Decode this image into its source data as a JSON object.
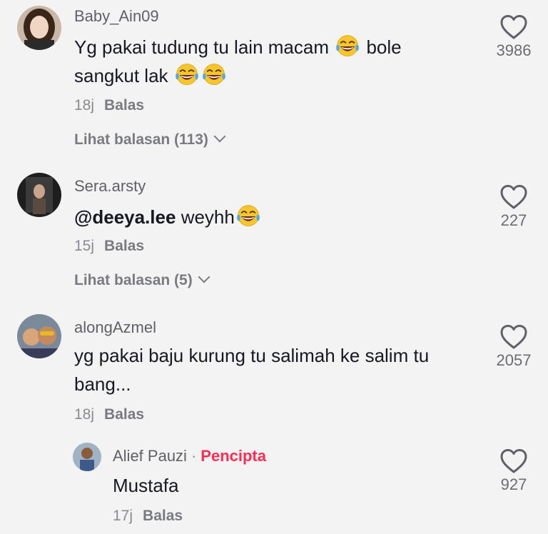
{
  "comments": [
    {
      "username": "Baby_Ain09",
      "text_part1": "Yg pakai tudung tu lain macam",
      "text_part2": "bole",
      "text_part3": "sangkut lak",
      "time": "18j",
      "reply": "Balas",
      "view_replies": "Lihat balasan (113)",
      "likes": "3986"
    },
    {
      "username": "Sera.arsty",
      "mention": "@deeya.lee",
      "text": "weyhh",
      "time": "15j",
      "reply": "Balas",
      "view_replies": "Lihat balasan (5)",
      "likes": "227"
    },
    {
      "username": "alongAzmel",
      "text": "yg pakai baju kurung tu salimah ke salim tu bang...",
      "time": "18j",
      "reply": "Balas",
      "likes": "2057"
    }
  ],
  "reply": {
    "username": "Alief Pauzi",
    "creator_label": "Pencipta",
    "text": "Mustafa",
    "time": "17j",
    "reply": "Balas",
    "likes": "927"
  },
  "icons": {
    "like": "heart-outline-icon",
    "emoji": "laughing-tears-emoji",
    "expand": "chevron-down-icon"
  },
  "colors": {
    "accent": "#fe2c55",
    "background": "#f3f3f3"
  }
}
